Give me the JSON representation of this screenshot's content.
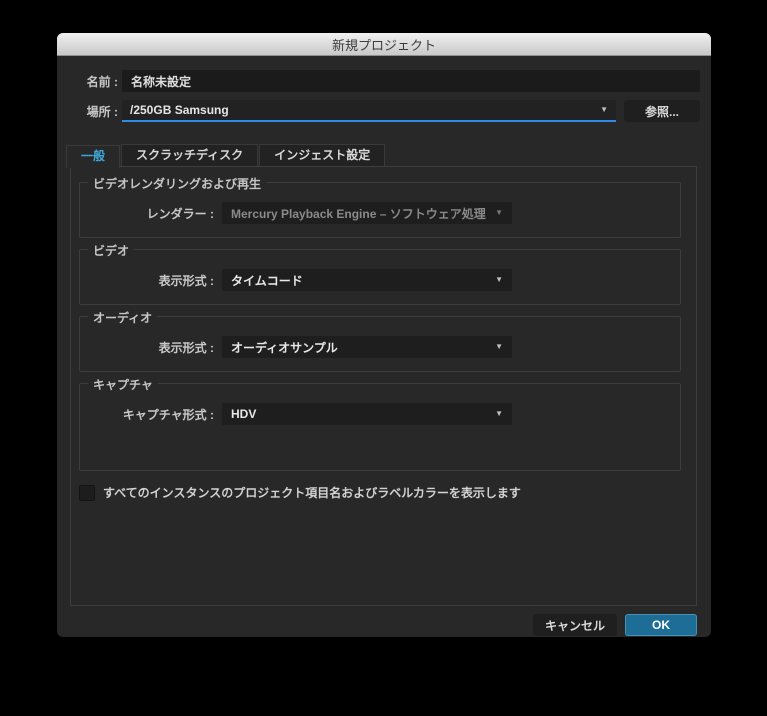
{
  "window": {
    "title": "新規プロジェクト"
  },
  "form": {
    "name_label": "名前 :",
    "name_value": "名称未設定",
    "location_label": "場所 :",
    "location_value": "/250GB Samsung",
    "browse_button": "参照..."
  },
  "tabs": [
    {
      "label": "一般",
      "active": true
    },
    {
      "label": "スクラッチディスク",
      "active": false
    },
    {
      "label": "インジェスト設定",
      "active": false
    }
  ],
  "sections": [
    {
      "title": "ビデオレンダリングおよび再生",
      "field_label": "レンダラー :",
      "value": "Mercury Playback Engine – ソフトウェア処理",
      "disabled": true
    },
    {
      "title": "ビデオ",
      "field_label": "表示形式 :",
      "value": "タイムコード",
      "disabled": false
    },
    {
      "title": "オーディオ",
      "field_label": "表示形式 :",
      "value": "オーディオサンプル",
      "disabled": false
    },
    {
      "title": "キャプチャ",
      "field_label": "キャプチャ形式 :",
      "value": "HDV",
      "disabled": false
    }
  ],
  "checkbox": {
    "label": "すべてのインスタンスのプロジェクト項目名およびラベルカラーを表示します",
    "checked": false
  },
  "footer": {
    "cancel_label": "キャンセル",
    "ok_label": "OK"
  },
  "colors": {
    "accent_underline": "#2d8ceb",
    "tab_active_text": "#3fa9dc",
    "ok_button": "#1d6d96",
    "dialog_background": "#282828"
  }
}
